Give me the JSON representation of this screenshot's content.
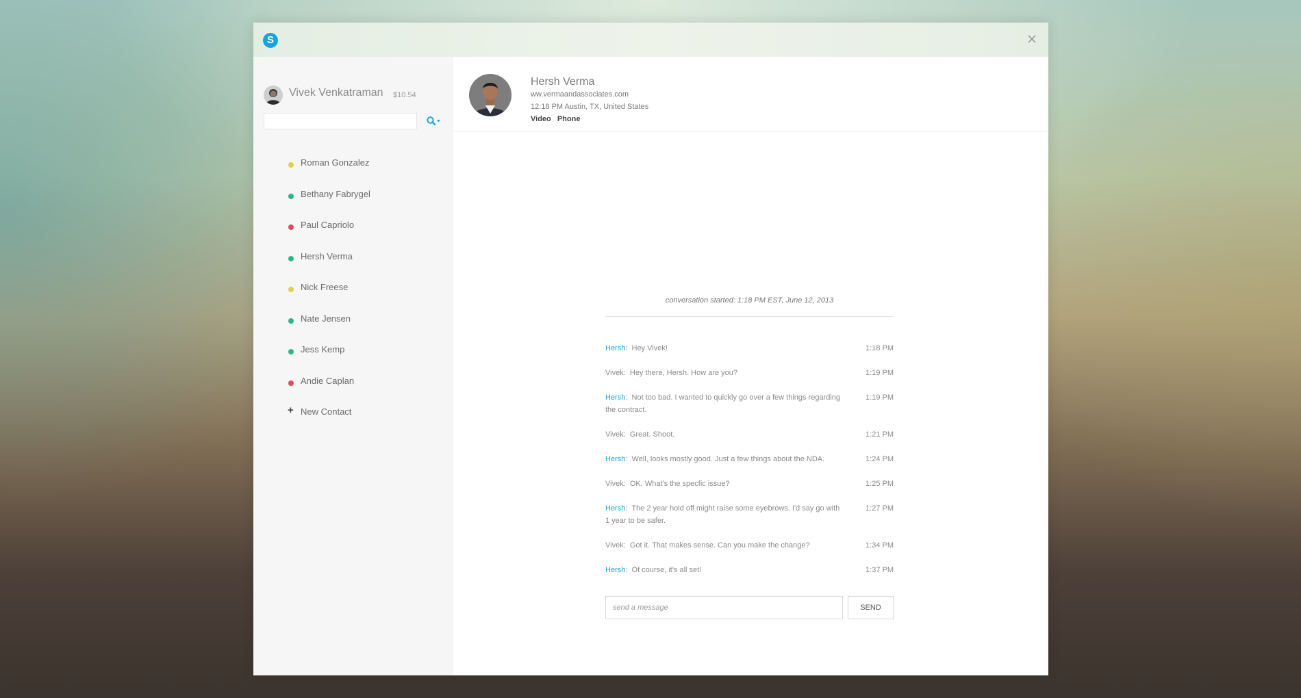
{
  "window": {
    "logo_glyph": "S",
    "close_icon": "close-icon",
    "accent_color": "#1aa4dc"
  },
  "me": {
    "name": "Vivek Venkatraman",
    "credit": "$10.54"
  },
  "search": {
    "value": "",
    "placeholder": ""
  },
  "contacts": [
    {
      "name": "Roman Gonzalez",
      "status_color": "#d9d44c"
    },
    {
      "name": "Bethany Fabrygel",
      "status_color": "#2fb58a"
    },
    {
      "name": "Paul Capriolo",
      "status_color": "#e04b5b"
    },
    {
      "name": "Hersh Verma",
      "status_color": "#2fb58a"
    },
    {
      "name": "Nick Freese",
      "status_color": "#d9d44c"
    },
    {
      "name": "Nate Jensen",
      "status_color": "#2fb58a"
    },
    {
      "name": "Jess Kemp",
      "status_color": "#2fb58a"
    },
    {
      "name": "Andie Caplan",
      "status_color": "#e04b5b"
    }
  ],
  "new_contact": {
    "plus": "+",
    "label": "New Contact"
  },
  "peer": {
    "name": "Hersh Verma",
    "url": "ww.vermaandassociates.com",
    "location": "12:18 PM Austin, TX, United States",
    "actions": [
      "Video",
      "Phone"
    ]
  },
  "conversation": {
    "started": "conversation started: 1:18 PM EST, June 12, 2013",
    "messages": [
      {
        "sender": "Hersh",
        "text": "Hey Vivek!",
        "time": "1:18 PM"
      },
      {
        "sender": "Vivek",
        "text": "Hey there, Hersh. How are you?",
        "time": "1:19 PM"
      },
      {
        "sender": "Hersh",
        "text": "Not too bad. I wanted to quickly go over a few things regarding the contract.",
        "time": "1:19 PM"
      },
      {
        "sender": "Vivek",
        "text": "Great. Shoot.",
        "time": "1:21 PM"
      },
      {
        "sender": "Hersh",
        "text": "Well, looks mostly good. Just a few things about the NDA.",
        "time": "1:24 PM"
      },
      {
        "sender": "Vivek",
        "text": "OK. What's the specfic issue?",
        "time": "1:25 PM"
      },
      {
        "sender": "Hersh",
        "text": "The 2 year hold off might raise some eyebrows. I'd say go with 1 year to be safer.",
        "time": "1:27 PM"
      },
      {
        "sender": "Vivek",
        "text": "Got it. That makes sense. Can you make the change?",
        "time": "1:34 PM"
      },
      {
        "sender": "Hersh",
        "text": "Of course, it's all set!",
        "time": "1:37 PM"
      }
    ]
  },
  "compose": {
    "value": "",
    "placeholder": "send a message",
    "send_label": "SEND"
  }
}
